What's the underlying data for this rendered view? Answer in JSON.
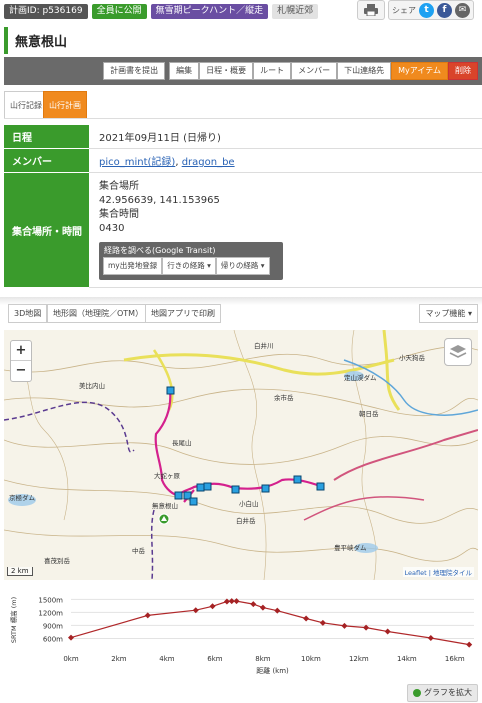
{
  "topbar": {
    "plan_id": "計画ID: p536169",
    "visibility": "全員に公開",
    "tag": "無雪期ピークハント／縦走",
    "area": "札幌近郊",
    "share_label": "シェア"
  },
  "title": "無意根山",
  "actions": [
    "計画書を提出",
    "編集",
    "日程・概要",
    "ルート",
    "メンバー",
    "下山連絡先",
    "Myアイテム",
    "削除"
  ],
  "tabs": [
    "山行記録",
    "山行計画"
  ],
  "info": {
    "date_label": "日程",
    "date_value": "2021年09月11日 (日帰り)",
    "members_label": "メンバー",
    "member1": "pico_mint(記録)",
    "member_sep": ", ",
    "member2": "dragon_be",
    "meet_label": "集合場所・時間",
    "meet_place_label": "集合場所",
    "meet_place_value": "42.956639, 141.153965",
    "meet_time_label": "集合時間",
    "meet_time_value": "0430",
    "route_title": "経路を調べる(Google Transit)",
    "route_buttons": [
      "my出発地登録",
      "行きの経路 ▾",
      "帰りの経路 ▾"
    ]
  },
  "map_toolbar": {
    "btn3d": "3D地図",
    "print_map": "地形図（地理院／OTM）",
    "print_app": "地図アプリで印刷",
    "map_func": "マップ機能 ▾"
  },
  "map": {
    "zoom_in": "+",
    "zoom_out": "−",
    "labels": [
      "美比内山",
      "白井川",
      "小天狗岳",
      "定山渓ダム",
      "朝日岳",
      "京極ダム",
      "長尾山",
      "大蛇ヶ原",
      "無意根山",
      "小白山",
      "白井岳",
      "豊平峡ダム",
      "中岳",
      "喜茂別岳",
      "余市岳"
    ],
    "scale": "2 km",
    "attribution": "Leaflet | 地理院タイル"
  },
  "elevation": {
    "ylabel": "SRTM 標高 (m)",
    "xlabel": "距離 (km)",
    "yticks": [
      "1500m",
      "1200m",
      "900m",
      "600m"
    ],
    "xticks": [
      "0km",
      "2km",
      "4km",
      "6km",
      "8km",
      "10km",
      "12km",
      "14km",
      "16km"
    ]
  },
  "chart_data": {
    "type": "line",
    "title": "",
    "xlabel": "距離 (km)",
    "ylabel": "SRTM 標高 (m)",
    "xlim": [
      0,
      16.8
    ],
    "ylim": [
      450,
      1600
    ],
    "x": [
      0,
      3.2,
      5.2,
      5.9,
      6.5,
      6.7,
      6.9,
      7.6,
      8.0,
      8.6,
      9.8,
      10.5,
      11.4,
      12.3,
      13.2,
      15.0,
      16.6
    ],
    "y": [
      620,
      1130,
      1250,
      1340,
      1450,
      1460,
      1460,
      1390,
      1310,
      1240,
      1060,
      960,
      890,
      850,
      760,
      610,
      460
    ]
  },
  "expand_label": "グラフを拡大"
}
